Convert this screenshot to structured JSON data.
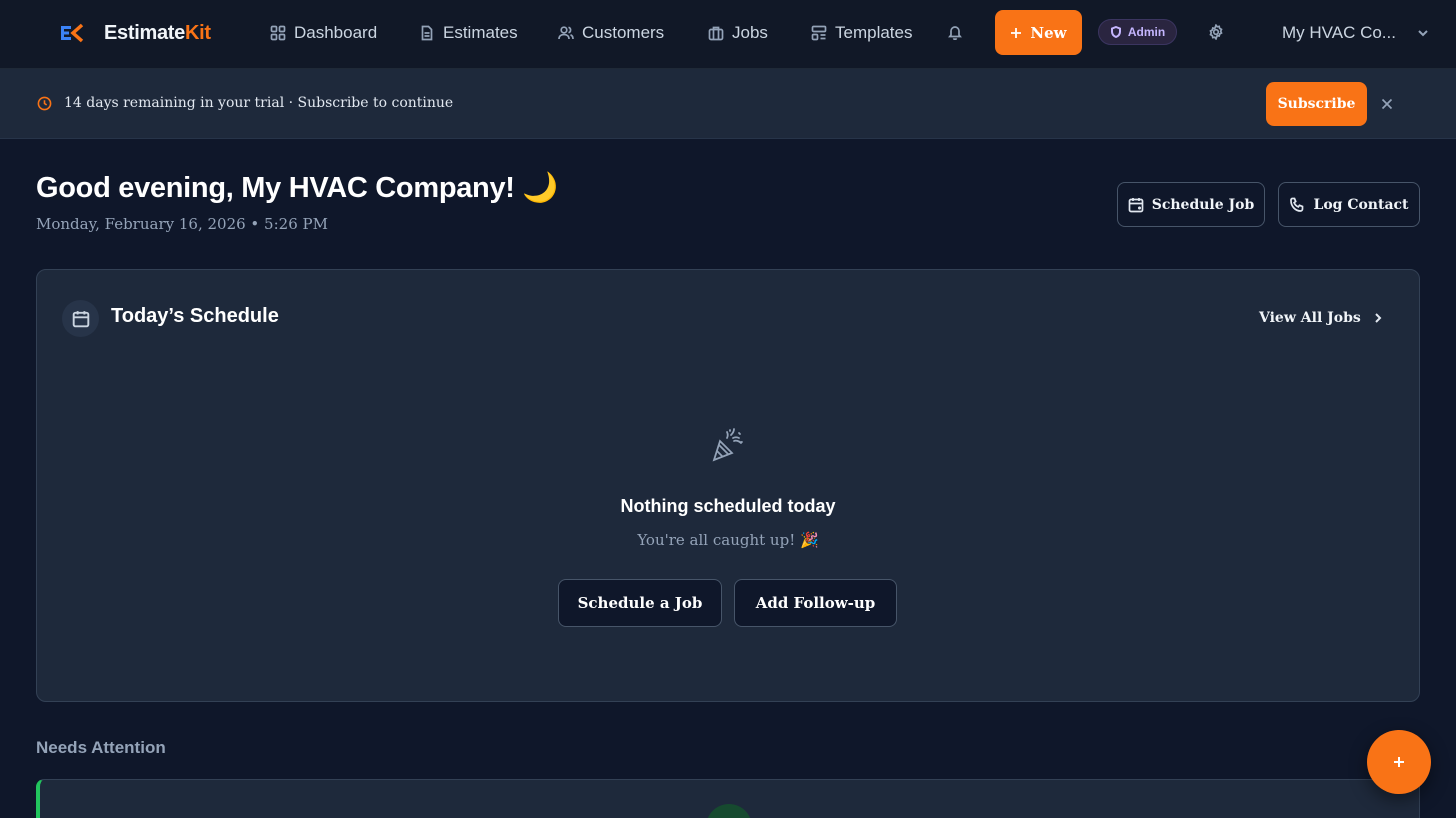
{
  "app": {
    "logo_mark": "EK",
    "name_main": "Estimate",
    "name_accent": "Kit",
    "brand_color": "#f97316"
  },
  "nav": {
    "items": [
      {
        "label": "Dashboard",
        "icon": "grid-icon"
      },
      {
        "label": "Estimates",
        "icon": "document-icon"
      },
      {
        "label": "Customers",
        "icon": "users-icon"
      },
      {
        "label": "Jobs",
        "icon": "briefcase-icon"
      },
      {
        "label": "Templates",
        "icon": "layout-icon"
      }
    ],
    "new_label": "New",
    "admin_label": "Admin",
    "company_label": "My HVAC Co..."
  },
  "trial": {
    "text": "14 days remaining in your trial · Subscribe to continue",
    "subscribe_label": "Subscribe"
  },
  "header": {
    "greeting": "Good evening, My HVAC Company! 🌙",
    "datetime": "Monday, February 16, 2026 • 5:26 PM",
    "schedule_job_label": "Schedule Job",
    "log_contact_label": "Log Contact"
  },
  "schedule": {
    "title": "Today’s Schedule",
    "view_all_label": "View All Jobs",
    "empty_title": "Nothing scheduled today",
    "empty_subtitle": "You're all caught up! 🎉",
    "schedule_job_label": "Schedule a Job",
    "add_followup_label": "Add Follow-up"
  },
  "attention": {
    "title": "Needs Attention",
    "accent_color": "#22c55e"
  }
}
